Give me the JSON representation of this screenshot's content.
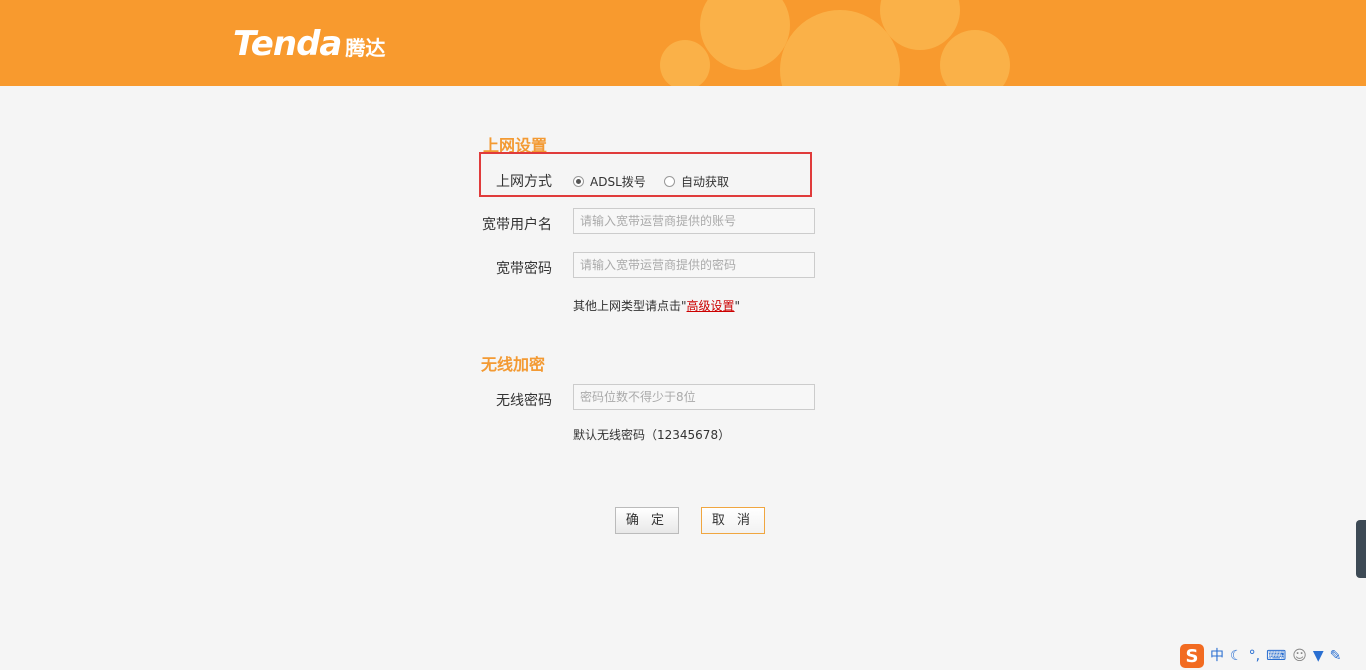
{
  "header": {
    "logo_latin": "Tenda",
    "logo_cn": "腾达",
    "brand_color": "#f89a2e"
  },
  "internet": {
    "title": "上网设置",
    "mode_label": "上网方式",
    "mode_options": [
      {
        "label": "ADSL拨号",
        "selected": true
      },
      {
        "label": "自动获取",
        "selected": false
      }
    ],
    "username_label": "宽带用户名",
    "username_placeholder": "请输入宽带运营商提供的账号",
    "password_label": "宽带密码",
    "password_placeholder": "请输入宽带运营商提供的密码",
    "hint_prefix": "其他上网类型请点击\"",
    "hint_link": "高级设置",
    "hint_suffix": "\""
  },
  "wireless": {
    "title": "无线加密",
    "password_label": "无线密码",
    "password_placeholder": "密码位数不得少于8位",
    "default_hint": "默认无线密码（12345678）"
  },
  "buttons": {
    "ok": "确 定",
    "cancel": "取 消"
  },
  "tray": {
    "ime_logo": "S",
    "ime_mode": "中",
    "icons": [
      "moon-icon",
      "punctuation-icon",
      "keyboard-icon",
      "user-icon",
      "shirt-icon",
      "wrench-icon"
    ]
  }
}
